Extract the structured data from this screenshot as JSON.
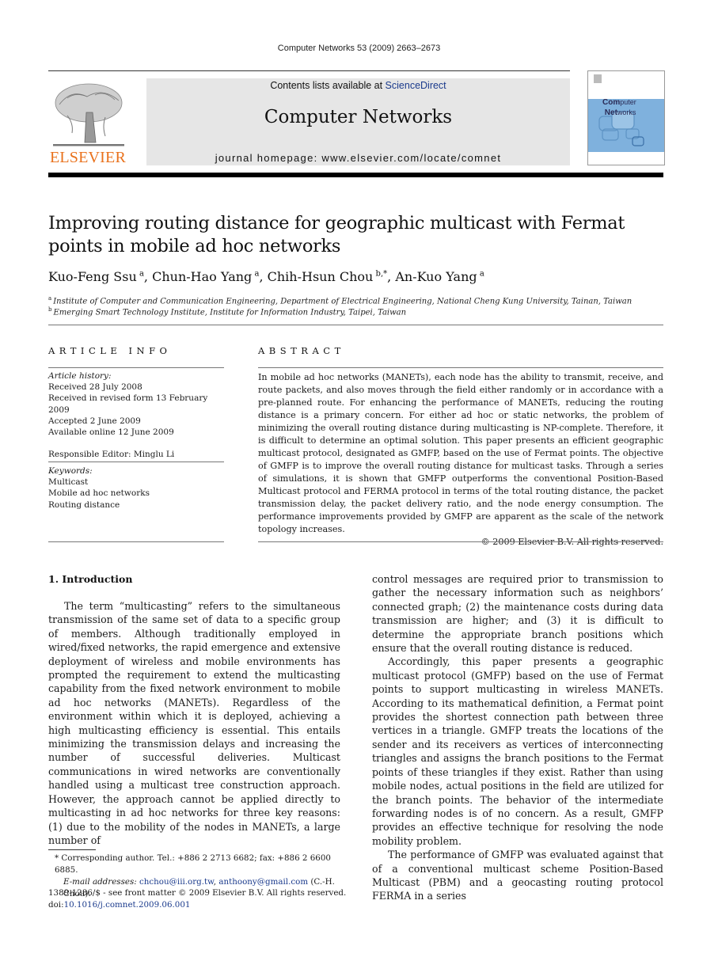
{
  "running_head": "Computer Networks 53 (2009) 2663–2673",
  "publisher": {
    "logo_word": "ELSEVIER",
    "logo_color": "#e9711c"
  },
  "banner": {
    "contents_prefix": "Contents lists available at ",
    "contents_link": "ScienceDirect",
    "journal_title": "Computer Networks",
    "homepage": "journal homepage: www.elsevier.com/locate/comnet"
  },
  "cover": {
    "line1_bold": "Com",
    "line1_rest": "puter",
    "line2_bold": "Net",
    "line2_rest": "works"
  },
  "article": {
    "title": "Improving routing distance for geographic multicast with Fermat points in mobile ad hoc networks",
    "authors": [
      {
        "name": "Kuo-Feng Ssu",
        "sup": "a",
        "sep": ", "
      },
      {
        "name": "Chun-Hao Yang",
        "sup": "a",
        "sep": ", "
      },
      {
        "name": "Chih-Hsun Chou",
        "sup": "b,*",
        "sep": ", "
      },
      {
        "name": "An-Kuo Yang",
        "sup": "a",
        "sep": ""
      }
    ],
    "affiliations": [
      {
        "sup": "a",
        "text": "Institute of Computer and Communication Engineering, Department of Electrical Engineering, National Cheng Kung University, Tainan, Taiwan"
      },
      {
        "sup": "b",
        "text": "Emerging Smart Technology Institute, Institute for Information Industry, Taipei, Taiwan"
      }
    ]
  },
  "article_info": {
    "heading": "ARTICLE INFO",
    "history_label": "Article history:",
    "history": [
      "Received 28 July 2008",
      "Received in revised form 13 February 2009",
      "Accepted 2 June 2009",
      "Available online 12 June 2009"
    ],
    "editor": "Responsible Editor: Minglu Li",
    "keywords_label": "Keywords:",
    "keywords": [
      "Multicast",
      "Mobile ad hoc networks",
      "Routing distance"
    ]
  },
  "abstract": {
    "heading": "ABSTRACT",
    "text": "In mobile ad hoc networks (MANETs), each node has the ability to transmit, receive, and route packets, and also moves through the field either randomly or in accordance with a pre-planned route. For enhancing the performance of MANETs, reducing the routing distance is a primary concern. For either ad hoc or static networks, the problem of minimizing the overall routing distance during multicasting is NP-complete. Therefore, it is difficult to determine an optimal solution. This paper presents an efficient geographic multicast protocol, designated as GMFP, based on the use of Fermat points. The objective of GMFP is to improve the overall routing distance for multicast tasks. Through a series of simulations, it is shown that GMFP outperforms the conventional Position-Based Multicast protocol and FERMA protocol in terms of the total routing distance, the packet transmission delay, the packet delivery ratio, and the node energy consumption. The performance improvements provided by GMFP are apparent as the scale of the network topology increases.",
    "copyright": "© 2009 Elsevier B.V. All rights reserved."
  },
  "body": {
    "section_heading": "1.  Introduction",
    "left_paragraphs": [
      "The term “multicasting” refers to the simultaneous transmission of the same set of data to a specific group of members. Although traditionally employed in wired/fixed networks, the rapid emergence and extensive deployment of wireless and mobile environments has prompted the requirement to extend the multicasting capability from the fixed network environment to mobile ad hoc networks (MANETs). Regardless of the environment within which it is deployed, achieving a high multicasting efficiency is essential. This entails minimizing the transmission delays and increasing the number of successful deliveries. Multicast communications in wired networks are conventionally handled using a multicast tree construction approach. However, the approach cannot be applied directly to multicasting in ad hoc networks for three key reasons: (1) due to the mobility of the nodes in MANETs, a large number of"
    ],
    "right_continuation": "control messages are required prior to transmission to gather the necessary information such as neighbors’ connected graph; (2) the maintenance costs during data transmission are higher; and (3) it is difficult to determine the appropriate branch positions which ensure that the overall routing distance is reduced.",
    "right_paragraphs": [
      "Accordingly, this paper presents a geographic multicast protocol (GMFP) based on the use of Fermat points to support multicasting in wireless MANETs. According to its mathematical definition, a Fermat point provides the shortest connection path between three vertices in a triangle. GMFP treats the locations of the sender and its receivers as vertices of interconnecting triangles and assigns the branch positions to the Fermat points of these triangles if they exist. Rather than using mobile nodes, actual positions in the field are utilized for the branch points. The behavior of the intermediate forwarding nodes is of no concern. As a result, GMFP provides an effective technique for resolving the node mobility problem.",
      "The performance of GMFP was evaluated against that of a conventional multicast scheme Position-Based Multicast (PBM) and a geocasting routing protocol FERMA in a series"
    ]
  },
  "footnote": {
    "marker": "*",
    "corresponding": " Corresponding author. Tel.: +886 2 2713 6682; fax: +886 2 6600 6885.",
    "email_label": "E-mail addresses: ",
    "email1": "chchou@iii.org.tw",
    "email_sep": ", ",
    "email2": "anthoony@gmail.com",
    "email_suffix": " (C.-H. Chou)."
  },
  "front_matter": {
    "issn_line": "1389-1286/$ - see front matter © 2009 Elsevier B.V. All rights reserved.",
    "doi_prefix": "doi:",
    "doi": "10.1016/j.comnet.2009.06.001"
  }
}
